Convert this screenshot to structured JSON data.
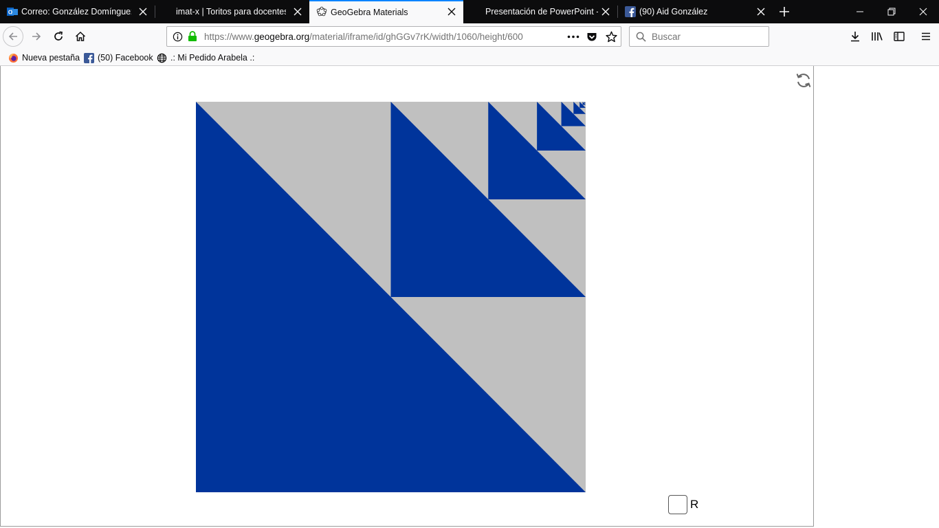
{
  "tabs": [
    {
      "title": "Correo: González Domínguez -",
      "icon": "outlook-icon",
      "active": false
    },
    {
      "title": "imat-x | Toritos para docentes",
      "icon": "none",
      "active": false
    },
    {
      "title": "GeoGebra Materials",
      "icon": "geogebra-icon",
      "active": true
    },
    {
      "title": "Presentación de PowerPoint - c",
      "icon": "none",
      "active": false
    },
    {
      "title": "(90) Aid González",
      "icon": "facebook-icon",
      "active": false
    }
  ],
  "address": {
    "prefix": "https://www.",
    "domain": "geogebra.org",
    "path": "/material/iframe/id/ghGGv7rK/width/1060/height/600"
  },
  "search": {
    "placeholder": "Buscar"
  },
  "bookmarks": [
    {
      "label": "Nueva pestaña",
      "icon": "firefox-icon"
    },
    {
      "label": "(50) Facebook",
      "icon": "facebook-icon"
    },
    {
      "label": ".: Mi Pedido Arabela .:",
      "icon": "globe-icon"
    }
  ],
  "applet": {
    "checkbox_label": "R",
    "checkbox_checked": false,
    "colors": {
      "blue": "#00349b",
      "gray": "#c0c0c0"
    }
  },
  "colors": {
    "tab_bg": "#0c0c0d",
    "accent": "#0a84ff",
    "toolbar_bg": "#f9f9fa"
  }
}
